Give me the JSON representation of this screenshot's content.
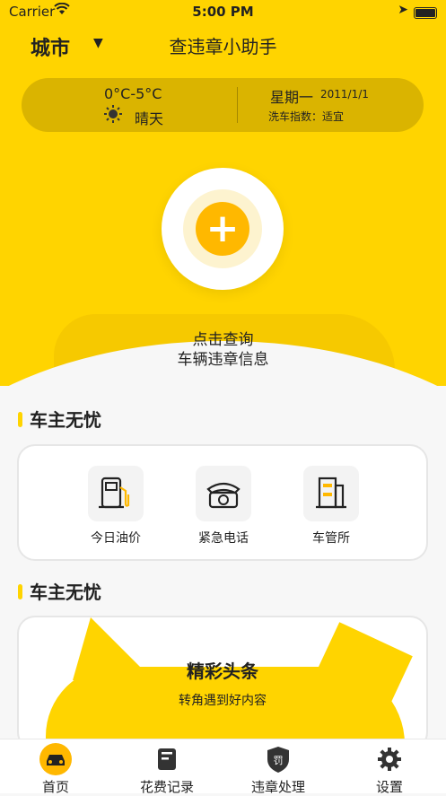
{
  "status": {
    "carrier": "Carrier",
    "time": "5:00 PM"
  },
  "header": {
    "city": "城市",
    "title": "查违章小助手"
  },
  "weather": {
    "temperature": "0°C-5°C",
    "condition": "晴天",
    "weekday": "星期一",
    "date": "2011/1/1",
    "wash_index": "洗车指数：适宜"
  },
  "query": {
    "line1": "点击查询",
    "line2": "车辆违章信息"
  },
  "section1": {
    "title": "车主无忧"
  },
  "services": [
    {
      "label": "今日油价",
      "icon": "fuel-pump-icon"
    },
    {
      "label": "紧急电话",
      "icon": "telephone-icon"
    },
    {
      "label": "车管所",
      "icon": "building-icon"
    }
  ],
  "section2": {
    "title": "车主无忧"
  },
  "news": {
    "headline": "精彩头条",
    "subtitle": "转角遇到好内容"
  },
  "tabs": [
    {
      "label": "首页",
      "icon": "car-icon",
      "active": true
    },
    {
      "label": "花费记录",
      "icon": "note-icon"
    },
    {
      "label": "违章处理",
      "icon": "penalty-shield-icon"
    },
    {
      "label": "设置",
      "icon": "gear-icon"
    }
  ],
  "colors": {
    "accent": "#FFD400",
    "button": "#FFB800"
  }
}
